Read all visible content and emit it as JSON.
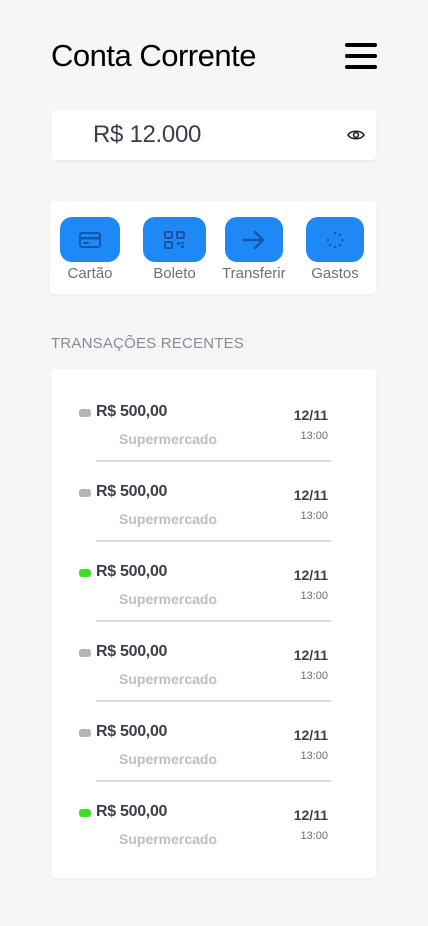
{
  "header": {
    "title": "Conta Corrente",
    "menu_icon": "hamburger-menu-icon"
  },
  "balance": {
    "value": "R$ 12.000",
    "visibility_icon": "eye-icon"
  },
  "actions": [
    {
      "label": "Cartão",
      "icon": "card-icon"
    },
    {
      "label": "Boleto",
      "icon": "qr-code-icon"
    },
    {
      "label": "Transferir",
      "icon": "arrow-right-icon"
    },
    {
      "label": "Gastos",
      "icon": "loading-spinner-icon"
    }
  ],
  "section": {
    "recent_label": "TRANSAÇÕES RECENTES"
  },
  "transactions": [
    {
      "amount": "R$ 500,00",
      "merchant": "Supermercado",
      "date": "12/11",
      "time": "13:00",
      "status_color": "#b3b3b8"
    },
    {
      "amount": "R$ 500,00",
      "merchant": "Supermercado",
      "date": "12/11",
      "time": "13:00",
      "status_color": "#b3b3b8"
    },
    {
      "amount": "R$ 500,00",
      "merchant": "Supermercado",
      "date": "12/11",
      "time": "13:00",
      "status_color": "#3ddc2f"
    },
    {
      "amount": "R$ 500,00",
      "merchant": "Supermercado",
      "date": "12/11",
      "time": "13:00",
      "status_color": "#b3b3b8"
    },
    {
      "amount": "R$ 500,00",
      "merchant": "Supermercado",
      "date": "12/11",
      "time": "13:00",
      "status_color": "#b3b3b8"
    },
    {
      "amount": "R$ 500,00",
      "merchant": "Supermercado",
      "date": "12/11",
      "time": "13:00",
      "status_color": "#3ddc2f"
    }
  ],
  "colors": {
    "accent": "#1e88f6",
    "background": "#f6f5f8"
  }
}
